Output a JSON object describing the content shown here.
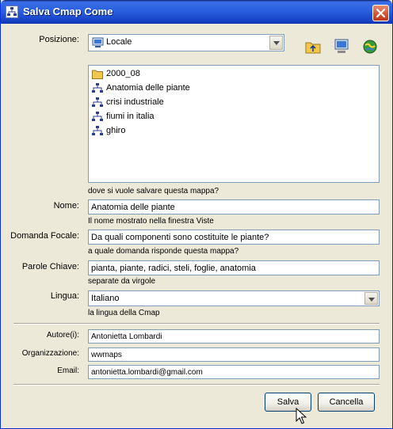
{
  "window": {
    "title": "Salva Cmap Come"
  },
  "location": {
    "label": "Posizione:",
    "selected": "Locale",
    "hint": "dove si vuole salvare questa mappa?"
  },
  "files": [
    {
      "name": "2000_08",
      "icon": "folder-icon"
    },
    {
      "name": "Anatomia delle piante",
      "icon": "cmap-icon"
    },
    {
      "name": "crisi industriale",
      "icon": "cmap-icon"
    },
    {
      "name": "fiumi in italia",
      "icon": "cmap-icon"
    },
    {
      "name": "ghiro",
      "icon": "cmap-icon"
    }
  ],
  "form": {
    "name": {
      "label": "Nome:",
      "value": "Anatomia delle piante",
      "hint": "Il nome mostrato nella finestra Viste"
    },
    "focus": {
      "label": "Domanda Focale:",
      "value": "Da quali componenti sono costituite le piante?",
      "hint": "a quale domanda risponde questa mappa?"
    },
    "keywords": {
      "label": "Parole Chiave:",
      "value": "pianta, piante, radici, steli, foglie, anatomia",
      "hint": "separate da virgole"
    },
    "language": {
      "label": "Lingua:",
      "value": "Italiano",
      "hint": "la lingua della Cmap"
    },
    "author": {
      "label": "Autore(i):",
      "value": "Antonietta Lombardi"
    },
    "organization": {
      "label": "Organizzazione:",
      "value": "wwmaps"
    },
    "email": {
      "label": "Email:",
      "value": "antonietta.lombardi@gmail.com"
    }
  },
  "buttons": {
    "save": "Salva",
    "cancel": "Cancella"
  },
  "colors": {
    "titlebar": "#2a5fe0",
    "dialog_bg": "#ece9d8",
    "folder": "#f3c84a",
    "cmap": "#2c3e8f"
  }
}
